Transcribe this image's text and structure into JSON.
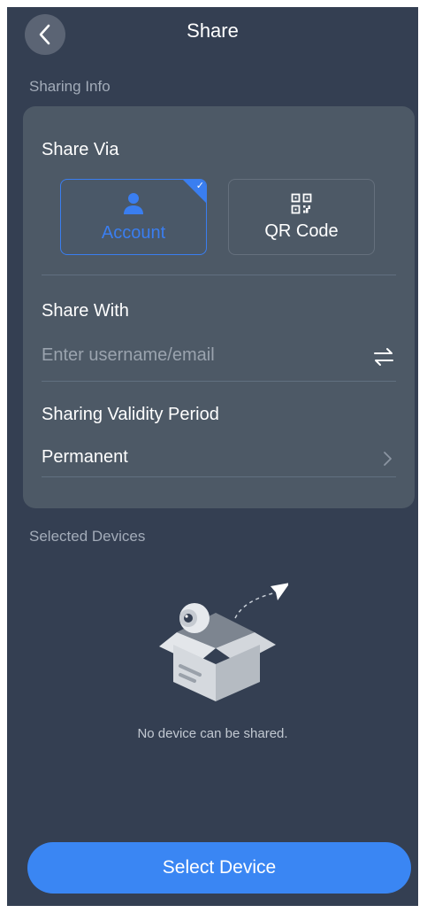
{
  "header": {
    "title": "Share",
    "back_icon": "chevron-left-icon"
  },
  "sharing_info": {
    "section_label": "Sharing Info",
    "share_via": {
      "label": "Share Via",
      "options": [
        {
          "label": "Account",
          "icon": "person-icon",
          "selected": true
        },
        {
          "label": "QR Code",
          "icon": "qr-code-icon",
          "selected": false
        }
      ]
    },
    "share_with": {
      "label": "Share With",
      "placeholder": "Enter username/email",
      "value": "",
      "action_icon": "swap-icon"
    },
    "validity": {
      "label": "Sharing Validity Period",
      "value": "Permanent",
      "icon": "chevron-right-icon"
    }
  },
  "devices": {
    "section_label": "Selected Devices",
    "empty_message": "No device can be shared.",
    "empty_icon": "empty-box-icon"
  },
  "footer": {
    "button_label": "Select Device"
  },
  "colors": {
    "background": "#343f52",
    "card": "#4d5966",
    "accent": "#3a86f3",
    "selected_border": "#3a7ef0"
  }
}
